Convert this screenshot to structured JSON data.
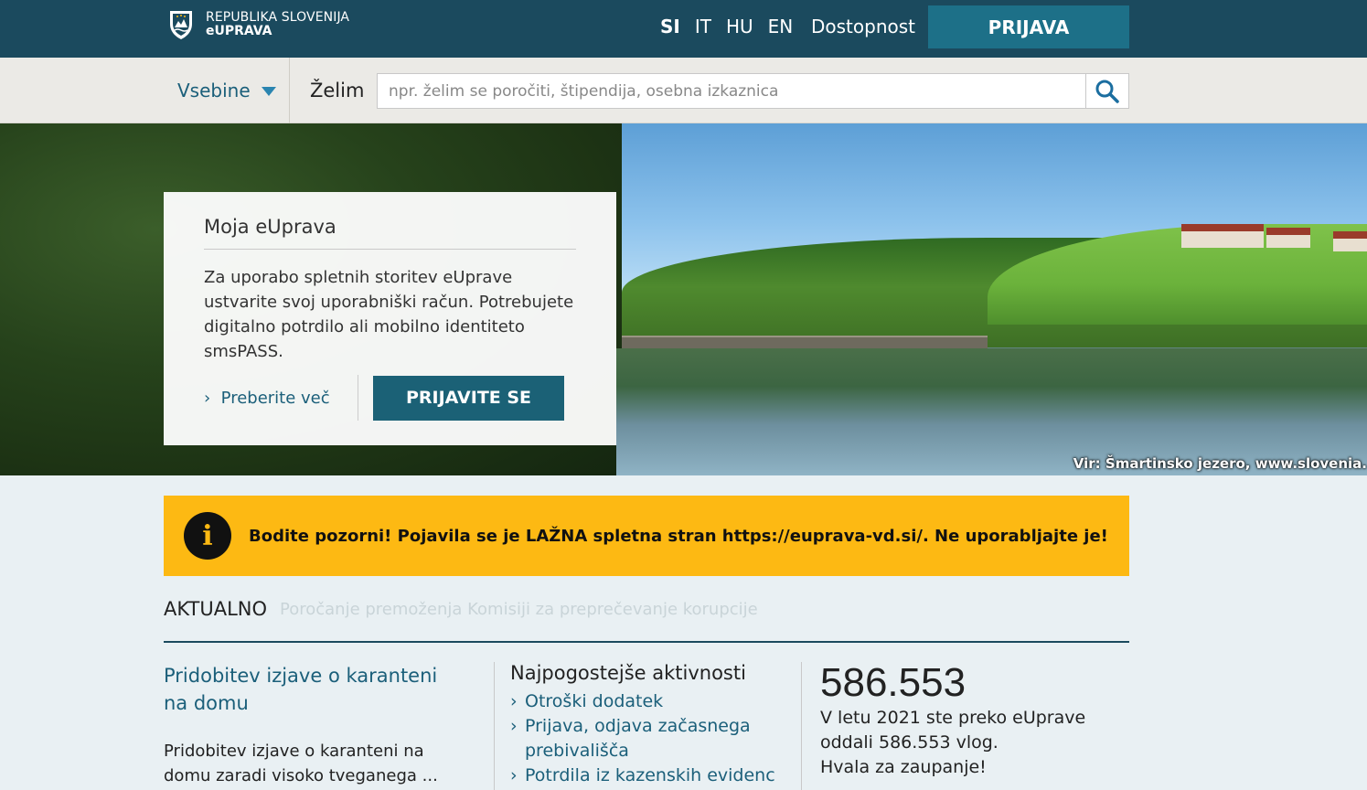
{
  "header": {
    "logo_line1": "REPUBLIKA SLOVENIJA",
    "logo_line2": "eUPRAVA",
    "languages": [
      "SI",
      "IT",
      "HU",
      "EN"
    ],
    "accessibility_label": "Dostopnost",
    "login_label": "PRIJAVA"
  },
  "search": {
    "menu_label": "Vsebine",
    "prefix_label": "Želim",
    "placeholder": "npr. želim se poročiti, štipendija, osebna izkaznica"
  },
  "hero": {
    "caption": "Vir: Šmartinsko jezero, www.slovenia."
  },
  "card": {
    "title": "Moja eUprava",
    "text": "Za uporabo spletnih storitev eUprave ustvarite svoj uporabniški račun. Potrebujete digitalno potrdilo ali mobilno identiteto smsPASS.",
    "more_label": "Preberite več",
    "signin_label": "PRIJAVITE SE"
  },
  "alert": {
    "icon_glyph": "i",
    "text": "Bodite pozorni! Pojavila se je LAŽNA spletna stran https://euprava-vd.si/. Ne uporabljajte je!"
  },
  "news": {
    "heading": "AKTUALNO",
    "ticker": "Poročanje premoženja Komisiji za preprečevanje korupcije"
  },
  "featured": {
    "title": "Pridobitev izjave o karanteni na domu",
    "text": "Pridobitev izjave o karanteni na domu zaradi visoko tveganega ..."
  },
  "activities": {
    "title": "Najpogostejše aktivnosti",
    "items": [
      "Otroški dodatek",
      "Prijava, odjava začasnega prebivališča",
      "Potrdila iz kazenskih evidenc"
    ]
  },
  "stats": {
    "number": "586.553",
    "text_line1": "V letu 2021 ste preko eUprave oddali 586.553 vlog.",
    "text_line2": "Hvala za zaupanje!"
  },
  "colors": {
    "header_bg": "#1b4a5e",
    "button_bg": "#1d7088",
    "link": "#1b5f7a",
    "alert_bg": "#fdb913"
  }
}
